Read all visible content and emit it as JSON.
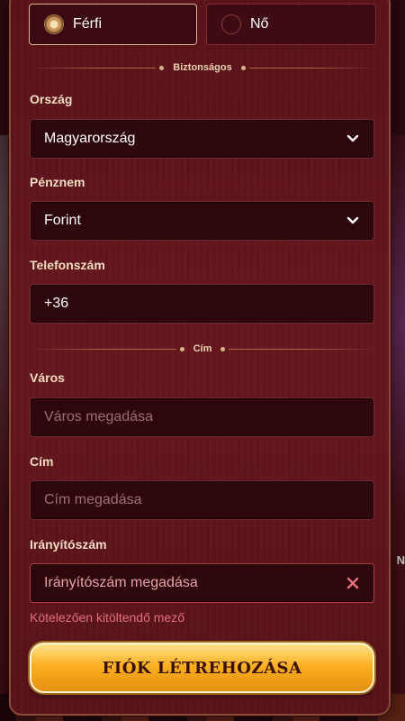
{
  "gender": {
    "male_label": "Férfi",
    "female_label": "Nő",
    "selected": "male"
  },
  "sections": {
    "security_label": "Biztonságos",
    "address_label": "Cím"
  },
  "country": {
    "label": "Ország",
    "value": "Magyarország"
  },
  "currency": {
    "label": "Pénznem",
    "value": "Forint"
  },
  "phone": {
    "label": "Telefonszám",
    "value": "+36"
  },
  "city": {
    "label": "Város",
    "placeholder": "Város megadása"
  },
  "address": {
    "label": "Cím",
    "placeholder": "Cím megadása"
  },
  "zip": {
    "label": "Irányítószám",
    "placeholder": "Irányítószám megadása",
    "error": "Kötelezően kitöltendő mező"
  },
  "submit_label": "FIÓK LÉTREHOZÁSA",
  "background": {
    "side_text": "N"
  },
  "colors": {
    "accent_gold": "#fbb021",
    "error": "#e0707a",
    "panel": "#641720"
  }
}
